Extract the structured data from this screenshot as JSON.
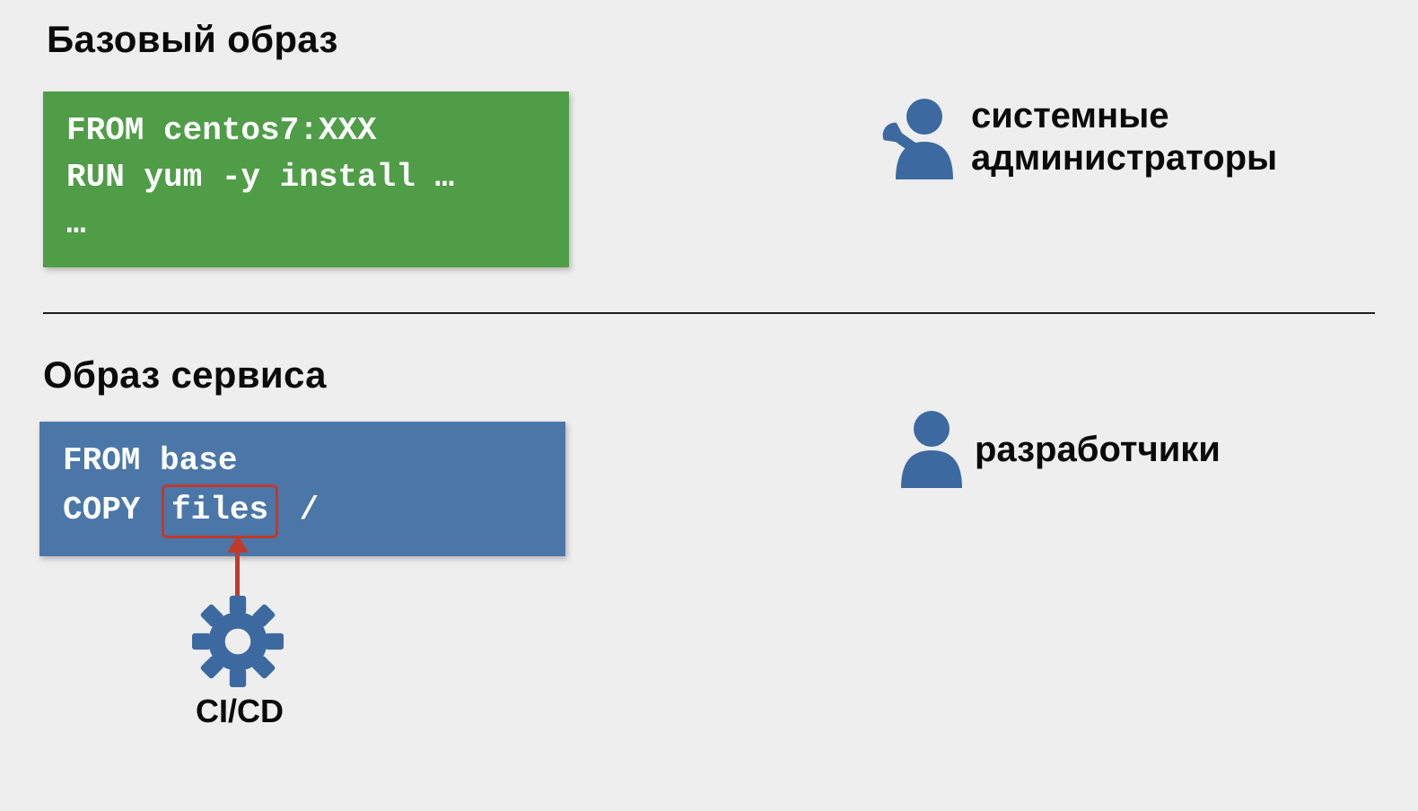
{
  "section1": {
    "title": "Базовый образ",
    "code_line1": "FROM centos7:XXX",
    "code_line2": "RUN yum -y install …",
    "code_line3": "…",
    "role_line1": "системные",
    "role_line2": "администраторы",
    "icon": "admin-wrench-icon"
  },
  "section2": {
    "title": "Образ сервиса",
    "code_pre": "FROM base\nCOPY ",
    "code_hl": "files",
    "code_post": " /",
    "role": "разработчики",
    "icon": "user-icon",
    "cicd_label": "CI/CD",
    "cicd_icon": "gear-icon"
  },
  "colors": {
    "accent_blue": "#3c6aa0",
    "box_green": "#4f9d47",
    "box_blue": "#4a77a8",
    "hl_red": "#c0392b"
  }
}
